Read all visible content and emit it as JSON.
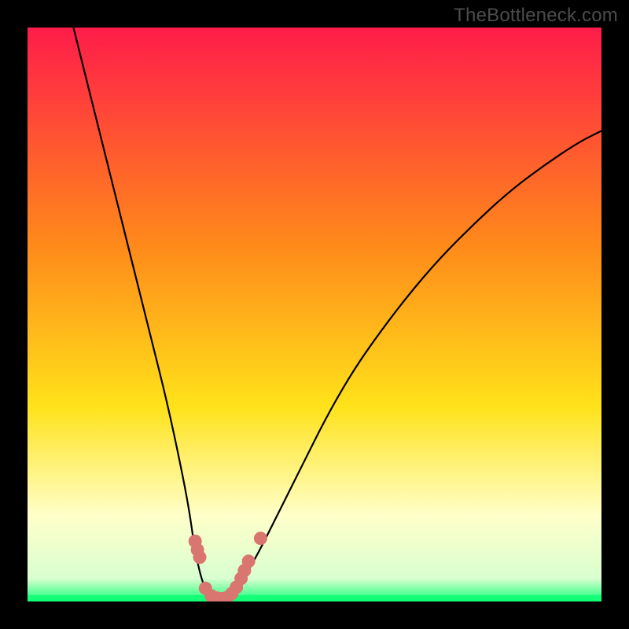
{
  "watermark": "TheBottleneck.com",
  "colors": {
    "frame": "#000000",
    "grad_top": "#ff1c4a",
    "grad_mid1": "#ff8a1a",
    "grad_mid2": "#ffe21a",
    "grad_pale": "#ffffc9",
    "grad_bottom": "#14ff78",
    "curve": "#000000",
    "dots": "#d9766f"
  },
  "chart_data": {
    "type": "line",
    "title": "",
    "xlabel": "",
    "ylabel": "",
    "xlim": [
      0,
      100
    ],
    "ylim": [
      0,
      100
    ],
    "series": [
      {
        "name": "bottleneck-curve",
        "x": [
          8,
          10,
          12,
          14,
          16,
          18,
          20,
          22,
          24,
          26,
          28,
          29,
          30,
          31,
          32,
          33.5,
          35,
          37,
          40,
          44,
          48,
          52,
          56,
          60,
          66,
          72,
          78,
          84,
          90,
          96,
          100
        ],
        "y": [
          100,
          92,
          84,
          76,
          68,
          60,
          52,
          44,
          36,
          27,
          17,
          10,
          5,
          2,
          0.8,
          0.4,
          0.8,
          3,
          8,
          16,
          24,
          32,
          39,
          45,
          53,
          60,
          66,
          71.5,
          76,
          80,
          82
        ]
      }
    ],
    "markers": [
      {
        "x": 29.2,
        "y": 10.5
      },
      {
        "x": 29.6,
        "y": 9.0
      },
      {
        "x": 30.0,
        "y": 7.7
      },
      {
        "x": 31.0,
        "y": 2.3
      },
      {
        "x": 32.0,
        "y": 1.0
      },
      {
        "x": 33.0,
        "y": 0.6
      },
      {
        "x": 34.0,
        "y": 0.5
      },
      {
        "x": 34.8,
        "y": 0.7
      },
      {
        "x": 35.6,
        "y": 1.4
      },
      {
        "x": 36.4,
        "y": 2.5
      },
      {
        "x": 37.2,
        "y": 4.0
      },
      {
        "x": 37.8,
        "y": 5.4
      },
      {
        "x": 38.5,
        "y": 7.0
      },
      {
        "x": 40.6,
        "y": 11.0
      }
    ],
    "green_band_y": 0
  }
}
